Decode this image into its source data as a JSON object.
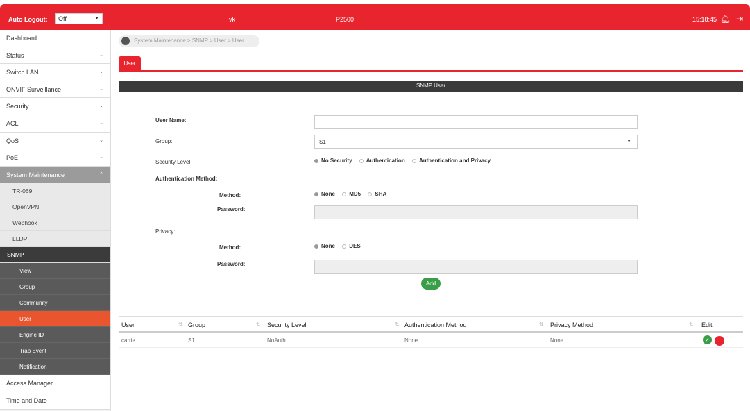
{
  "topbar": {
    "auto_logout_label": "Auto Logout:",
    "auto_logout_value": "Off",
    "brand": "vk",
    "model": "P2500",
    "clock": "15:18:45",
    "colors": {
      "accent": "#e8252f"
    }
  },
  "sidebar": {
    "items": [
      {
        "label": "Dashboard"
      },
      {
        "label": "Status"
      },
      {
        "label": "Switch LAN"
      },
      {
        "label": "ONVIF Surveillance"
      },
      {
        "label": "Security"
      },
      {
        "label": "ACL"
      },
      {
        "label": "QoS"
      },
      {
        "label": "PoE"
      },
      {
        "label": "System Maintenance"
      }
    ],
    "sub_items": [
      {
        "label": "TR-069"
      },
      {
        "label": "OpenVPN"
      },
      {
        "label": "Webhook"
      },
      {
        "label": "LLDP"
      },
      {
        "label": "SNMP"
      }
    ],
    "snmp_items": [
      {
        "label": "View"
      },
      {
        "label": "Group"
      },
      {
        "label": "Community"
      },
      {
        "label": "User"
      },
      {
        "label": "Engine ID"
      },
      {
        "label": "Trap Event"
      },
      {
        "label": "Notification"
      }
    ],
    "bottom_items": [
      {
        "label": "Access Manager"
      },
      {
        "label": "Time and Date"
      }
    ]
  },
  "breadcrumb": "System Maintenance > SNMP > User > User",
  "tab": {
    "label": "User"
  },
  "panel": {
    "title": "SNMP User"
  },
  "form": {
    "user_name_label": "User Name:",
    "user_name_value": "",
    "group_label": "Group:",
    "group_value": "S1",
    "security_level_label": "Security Level:",
    "security_options": [
      "No Security",
      "Authentication",
      "Authentication and Privacy"
    ],
    "auth_method_label": "Authentication Method:",
    "method_label": "Method:",
    "auth_method_options": [
      "None",
      "MD5",
      "SHA"
    ],
    "password_label": "Password:",
    "privacy_label": "Privacy:",
    "privacy_method_options": [
      "None",
      "DES"
    ],
    "add_label": "Add"
  },
  "table": {
    "headers": [
      "User",
      "Group",
      "Security Level",
      "Authentication Method",
      "Privacy Method",
      "Edit"
    ],
    "rows": [
      {
        "user": "carrie",
        "group": "S1",
        "security": "NoAuth",
        "auth": "None",
        "privacy": "None"
      }
    ]
  }
}
